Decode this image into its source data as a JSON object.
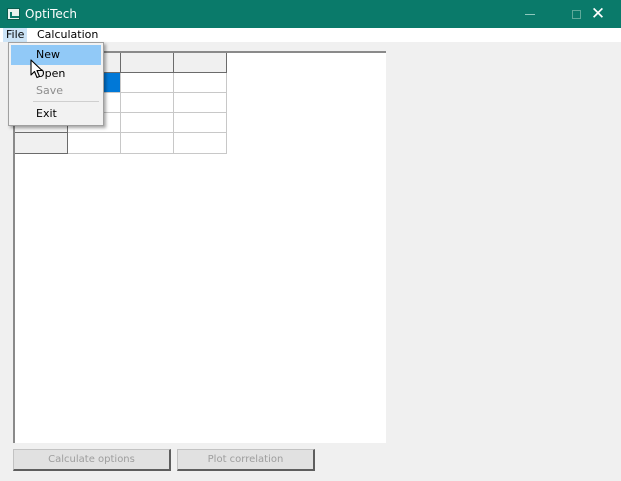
{
  "window": {
    "title": "OptiTech"
  },
  "menubar": {
    "file": "File",
    "calculation": "Calculation"
  },
  "file_menu": {
    "items": [
      {
        "label": "New",
        "state": "highlighted"
      },
      {
        "label": "Open",
        "state": "enabled"
      },
      {
        "label": "Save",
        "state": "disabled"
      },
      {
        "label": "Exit",
        "state": "enabled"
      }
    ]
  },
  "buttons": {
    "calculate_options": "Calculate options",
    "plot_correlation": "Plot correlation"
  },
  "colors": {
    "titlebar": "#0a7a6a",
    "selection": "#0078d7",
    "menu_highlight": "#91c9f7"
  }
}
